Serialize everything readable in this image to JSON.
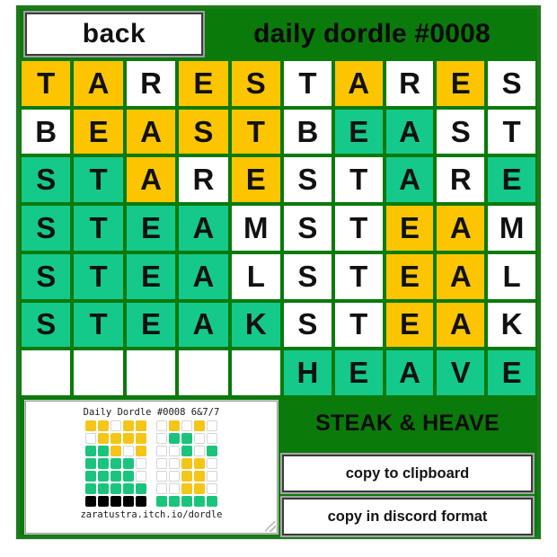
{
  "header": {
    "back_label": "back",
    "title": "daily dordle #0008"
  },
  "colors": {
    "background_green": "#0a7a0a",
    "tile_correct": "#15c98a",
    "tile_present": "#fdc500",
    "tile_absent": "#ffffff",
    "border_green": "#1d7a1d"
  },
  "boards": {
    "left": {
      "rows": [
        {
          "word": "TARES",
          "letters": [
            "T",
            "A",
            "R",
            "E",
            "S"
          ],
          "states": [
            "yellow",
            "yellow",
            "none",
            "yellow",
            "yellow"
          ]
        },
        {
          "word": "BEAST",
          "letters": [
            "B",
            "E",
            "A",
            "S",
            "T"
          ],
          "states": [
            "none",
            "yellow",
            "yellow",
            "yellow",
            "yellow"
          ]
        },
        {
          "word": "STARE",
          "letters": [
            "S",
            "T",
            "A",
            "R",
            "E"
          ],
          "states": [
            "green",
            "green",
            "yellow",
            "none",
            "yellow"
          ]
        },
        {
          "word": "STEAM",
          "letters": [
            "S",
            "T",
            "E",
            "A",
            "M"
          ],
          "states": [
            "green",
            "green",
            "green",
            "green",
            "none"
          ]
        },
        {
          "word": "STEAL",
          "letters": [
            "S",
            "T",
            "E",
            "A",
            "L"
          ],
          "states": [
            "green",
            "green",
            "green",
            "green",
            "none"
          ]
        },
        {
          "word": "STEAK",
          "letters": [
            "S",
            "T",
            "E",
            "A",
            "K"
          ],
          "states": [
            "green",
            "green",
            "green",
            "green",
            "green"
          ]
        },
        {
          "word": "",
          "letters": [
            "",
            "",
            "",
            "",
            ""
          ],
          "states": [
            "none",
            "none",
            "none",
            "none",
            "none"
          ]
        }
      ]
    },
    "right": {
      "rows": [
        {
          "word": "TARES",
          "letters": [
            "T",
            "A",
            "R",
            "E",
            "S"
          ],
          "states": [
            "none",
            "yellow",
            "none",
            "yellow",
            "none"
          ]
        },
        {
          "word": "BEAST",
          "letters": [
            "B",
            "E",
            "A",
            "S",
            "T"
          ],
          "states": [
            "none",
            "green",
            "green",
            "none",
            "none"
          ]
        },
        {
          "word": "STARE",
          "letters": [
            "S",
            "T",
            "A",
            "R",
            "E"
          ],
          "states": [
            "none",
            "none",
            "green",
            "none",
            "green"
          ]
        },
        {
          "word": "STEAM",
          "letters": [
            "S",
            "T",
            "E",
            "A",
            "M"
          ],
          "states": [
            "none",
            "none",
            "yellow",
            "yellow",
            "none"
          ]
        },
        {
          "word": "STEAL",
          "letters": [
            "S",
            "T",
            "E",
            "A",
            "L"
          ],
          "states": [
            "none",
            "none",
            "yellow",
            "yellow",
            "none"
          ]
        },
        {
          "word": "STEAK",
          "letters": [
            "S",
            "T",
            "E",
            "A",
            "K"
          ],
          "states": [
            "none",
            "none",
            "yellow",
            "yellow",
            "none"
          ]
        },
        {
          "word": "HEAVE",
          "letters": [
            "H",
            "E",
            "A",
            "V",
            "E"
          ],
          "states": [
            "green",
            "green",
            "green",
            "green",
            "green"
          ]
        }
      ]
    }
  },
  "share": {
    "heading": "Daily Dordle #0008 6&7/7",
    "footer": "zaratustra.itch.io/dordle",
    "squares": [
      {
        "left": [
          "yellow",
          "yellow",
          "none",
          "yellow",
          "yellow"
        ],
        "right": [
          "none",
          "yellow",
          "none",
          "yellow",
          "none"
        ]
      },
      {
        "left": [
          "none",
          "yellow",
          "yellow",
          "yellow",
          "yellow"
        ],
        "right": [
          "none",
          "green",
          "green",
          "none",
          "none"
        ]
      },
      {
        "left": [
          "green",
          "green",
          "yellow",
          "none",
          "yellow"
        ],
        "right": [
          "none",
          "none",
          "green",
          "none",
          "green"
        ]
      },
      {
        "left": [
          "green",
          "green",
          "green",
          "green",
          "none"
        ],
        "right": [
          "none",
          "none",
          "yellow",
          "yellow",
          "none"
        ]
      },
      {
        "left": [
          "green",
          "green",
          "green",
          "green",
          "none"
        ],
        "right": [
          "none",
          "none",
          "yellow",
          "yellow",
          "none"
        ]
      },
      {
        "left": [
          "green",
          "green",
          "green",
          "green",
          "green"
        ],
        "right": [
          "none",
          "none",
          "yellow",
          "yellow",
          "none"
        ]
      },
      {
        "left": [
          "black",
          "black",
          "black",
          "black",
          "black"
        ],
        "right": [
          "green",
          "green",
          "green",
          "green",
          "green"
        ]
      }
    ]
  },
  "result": {
    "answer_label": "STEAK & HEAVE",
    "copy_clipboard_label": "copy to clipboard",
    "copy_discord_label": "copy in discord format"
  }
}
